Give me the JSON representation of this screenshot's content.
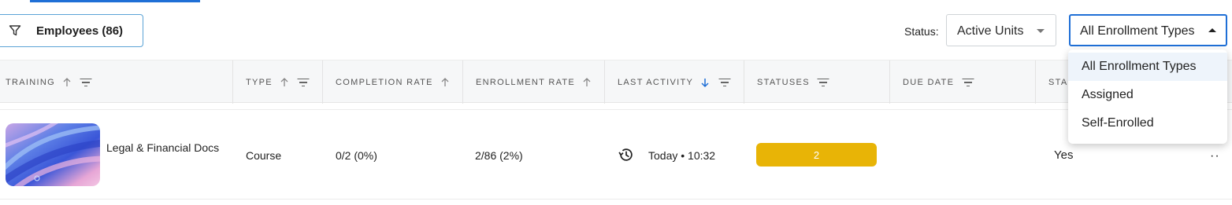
{
  "filter": {
    "label": "Employees (86)",
    "icon": "filter-icon"
  },
  "status_filter": {
    "label": "Status:",
    "value": "Active Units"
  },
  "enrollment_filter": {
    "value": "All Enrollment Types",
    "options": [
      "All Enrollment Types",
      "Assigned",
      "Self-Enrolled"
    ],
    "selected_index": 0
  },
  "table": {
    "columns": [
      {
        "label": "TRAINING",
        "sortable": true,
        "sort": "asc",
        "filterable": true
      },
      {
        "label": "TYPE",
        "sortable": true,
        "sort": "asc",
        "filterable": true
      },
      {
        "label": "COMPLETION RATE",
        "sortable": true,
        "sort": "asc",
        "filterable": false
      },
      {
        "label": "ENROLLMENT RATE",
        "sortable": true,
        "sort": "asc",
        "filterable": false
      },
      {
        "label": "LAST ACTIVITY",
        "sortable": true,
        "sort": "desc",
        "filterable": true
      },
      {
        "label": "STATUSES",
        "sortable": false,
        "filterable": true
      },
      {
        "label": "DUE DATE",
        "sortable": false,
        "filterable": true
      },
      {
        "label": "STA",
        "sortable": false,
        "filterable": false
      }
    ],
    "rows": [
      {
        "training": "Legal & Financial Docs",
        "type": "Course",
        "completion": "0/2 (0%)",
        "enrollment": "2/86 (2%)",
        "last_activity": "Today • 10:32",
        "statuses_count": "2",
        "due_date": "",
        "status_flag": "Yes"
      }
    ]
  },
  "colors": {
    "accent": "#1f6fd6",
    "status_pill": "#e8b406",
    "header_bg": "#f6f7f8"
  },
  "icons": {
    "sort_asc": "arrow-up-icon",
    "sort_desc": "arrow-down-icon",
    "column_filter": "filter-lines-icon",
    "history": "history-icon",
    "more": "more-icon"
  }
}
